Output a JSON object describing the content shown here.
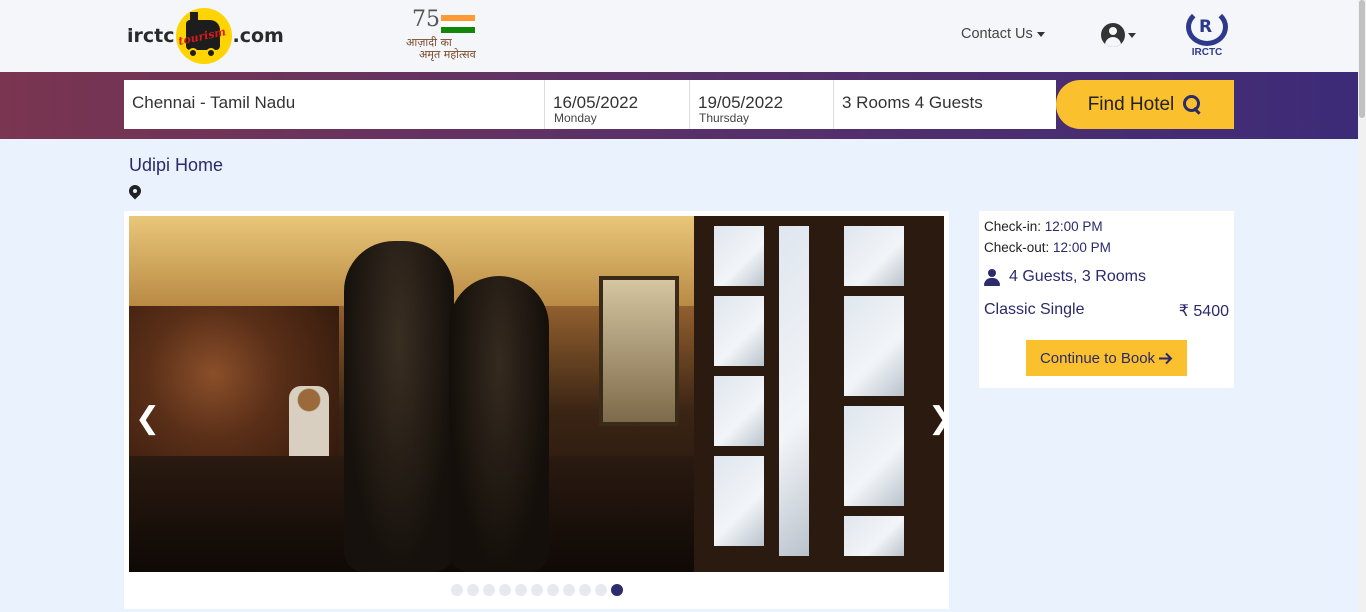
{
  "header": {
    "logo_left": "irctc",
    "logo_right": ".com",
    "logo_tourism": "tourism",
    "azadi_number": "75",
    "azadi_line1": "आज़ादी का",
    "azadi_line2": "अमृत महोत्सव",
    "contact_label": "Contact Us",
    "irctc_logo_text": "IRCTC"
  },
  "search": {
    "city": "Chennai - Tamil Nadu",
    "checkin_date": "16/05/2022",
    "checkin_day": "Monday",
    "checkout_date": "19/05/2022",
    "checkout_day": "Thursday",
    "rooms_guests": "3 Rooms 4 Guests",
    "find_label": "Find Hotel"
  },
  "hotel": {
    "name": "Udipi Home"
  },
  "gallery": {
    "prev_arrow": "❮",
    "next_arrow": "❯",
    "dot_count": 11,
    "active_dot": 11
  },
  "booking": {
    "checkin_label": "Check-in:",
    "checkin_time": "12:00 PM",
    "checkout_label": "Check-out:",
    "checkout_time": "12:00 PM",
    "guests_rooms": "4 Guests, 3 Rooms",
    "room_type": "Classic Single",
    "price": "₹ 5400",
    "continue_label": "Continue to Book"
  },
  "colors": {
    "accent_yellow": "#fbc02d",
    "navy": "#2a2a6a",
    "band_left": "#7a3550",
    "band_right": "#3d2b78"
  }
}
